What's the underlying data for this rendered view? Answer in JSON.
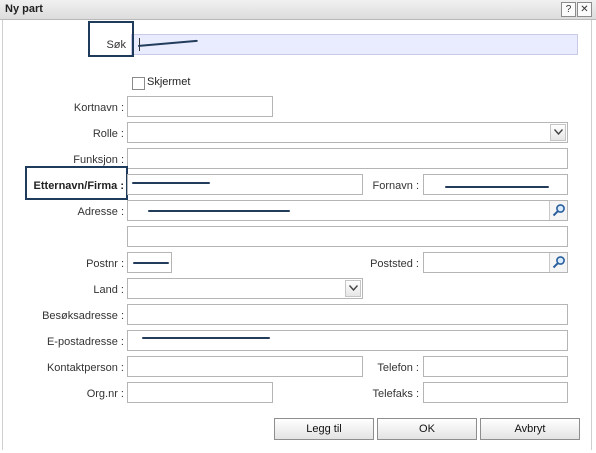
{
  "window": {
    "title": "Ny part",
    "help_glyph": "?",
    "close_glyph": "✕"
  },
  "search": {
    "label": "Søk",
    "value": ""
  },
  "skjermet": {
    "label": "Skjermet",
    "checked": false
  },
  "fields": {
    "kortnavn": "Kortnavn :",
    "rolle": "Rolle :",
    "funksjon": "Funksjon :",
    "etternavn": "Etternavn/Firma :",
    "fornavn": "Fornavn :",
    "adresse": "Adresse :",
    "postnr": "Postnr :",
    "poststed": "Poststed :",
    "land": "Land :",
    "besoksadresse": "Besøksadresse :",
    "epost": "E-postadresse :",
    "kontaktperson": "Kontaktperson :",
    "telefon": "Telefon :",
    "orgnr": "Org.nr :",
    "telefaks": "Telefaks :"
  },
  "buttons": {
    "add": "Legg til",
    "ok": "OK",
    "cancel": "Avbryt"
  },
  "icons": {
    "help": "help-icon",
    "close": "close-icon",
    "search": "magnifier-icon",
    "dropdown": "chevron-down-icon"
  },
  "colors": {
    "search_bg": "#e9ecff",
    "highlight": "#1f3b5c",
    "redaction": "#243c5c"
  }
}
